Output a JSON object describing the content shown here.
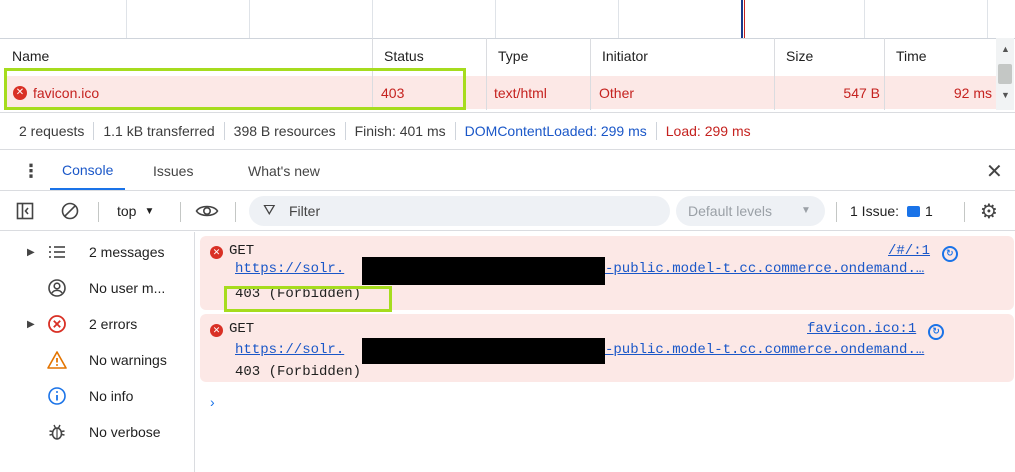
{
  "network": {
    "columns": [
      "Name",
      "Status",
      "Type",
      "Initiator",
      "Size",
      "Time"
    ],
    "row": {
      "name": "favicon.ico",
      "status": "403",
      "type": "text/html",
      "initiator": "Other",
      "size": "547 B",
      "time": "92 ms"
    }
  },
  "summary": {
    "requests": "2 requests",
    "transferred": "1.1 kB transferred",
    "resources": "398 B resources",
    "finish": "Finish: 401 ms",
    "dcl": "DOMContentLoaded: 299 ms",
    "load": "Load: 299 ms"
  },
  "drawer": {
    "tabs": [
      "Console",
      "Issues",
      "What's new"
    ],
    "active": "Console"
  },
  "toolbar": {
    "context": "top",
    "filter_placeholder": "Filter",
    "levels": "Default levels",
    "issues_label": "1 Issue:",
    "issues_count": "1"
  },
  "sidebar": {
    "items": [
      {
        "label": "2 messages",
        "icon": "list-icon",
        "expandable": true
      },
      {
        "label": "No user m...",
        "icon": "user-icon",
        "expandable": false
      },
      {
        "label": "2 errors",
        "icon": "error-icon",
        "expandable": true
      },
      {
        "label": "No warnings",
        "icon": "warning-icon",
        "expandable": false
      },
      {
        "label": "No info",
        "icon": "info-icon",
        "expandable": false
      },
      {
        "label": "No verbose",
        "icon": "bug-icon",
        "expandable": false
      }
    ]
  },
  "messages": [
    {
      "method": "GET",
      "url_start": "https://solr.",
      "url_end": "-public.model-t.cc.commerce.ondemand.…",
      "status": "403 (Forbidden)",
      "source": "/#/:1"
    },
    {
      "method": "GET",
      "url_start": "https://solr.",
      "url_end": "-public.model-t.cc.commerce.ondemand.…",
      "status": "403 (Forbidden)",
      "source": "favicon.ico:1"
    }
  ],
  "colors": {
    "error_bg": "#fce8e6",
    "error_text": "#c5221f",
    "link": "#1a57c8",
    "accent": "#1a73e8",
    "highlight": "#a6dc1e"
  }
}
